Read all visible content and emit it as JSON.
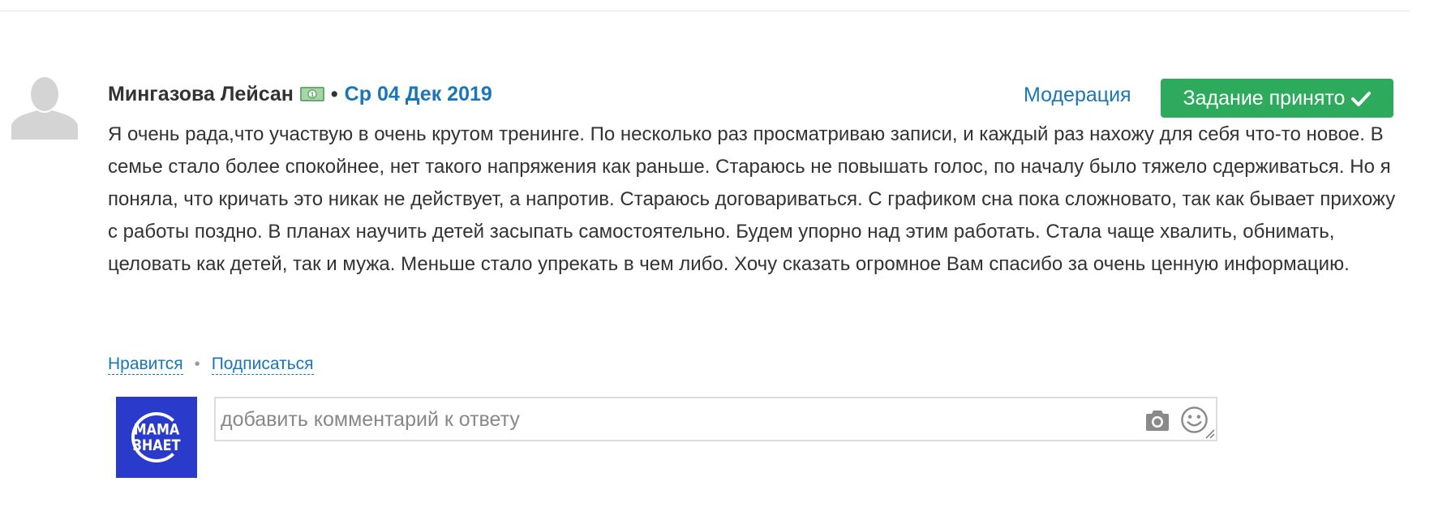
{
  "comment": {
    "author": "Мингазова Лейсан",
    "separator": "•",
    "date": "Ср 04 Дек 2019",
    "moderation_label": "Модерация",
    "status_button_label": "Задание принято",
    "text": "Я очень рада,что участвую в очень крутом тренинге. По несколько раз просматриваю записи, и каждый раз нахожу для себя что-то новое. В семье стало более спокойнее, нет такого напряжения как раньше. Стараюсь не повышать голос, по началу было тяжело сдерживаться. Но я поняла, что кричать это никак не действует, а напротив. Стараюсь договариваться. С графиком сна пока сложновато, так как бывает прихожу с работы поздно. В планах научить детей засыпать самостоятельно. Будем упорно над этим работать. Стала чаще хвалить, обнимать, целовать как детей, так и мужа. Меньше стало упрекать в чем либо. Хочу сказать огромное Вам спасибо за очень ценную информацию."
  },
  "actions": {
    "like_label": "Нравится",
    "separator": "•",
    "subscribe_label": "Подписаться"
  },
  "reply": {
    "placeholder": "добавить комментарий к ответу",
    "value": ""
  },
  "brand": {
    "line1": "МАМА",
    "line2": "ЗНАЕТ"
  },
  "icons": {
    "avatar": "user-silhouette-icon",
    "badge": "money-banknote-icon",
    "button": "checkmark-icon",
    "camera": "camera-icon",
    "emoji": "smiley-icon"
  },
  "colors": {
    "link": "#1976b8",
    "accepted_button": "#2eaa5c",
    "brand_background": "#2a3bcc",
    "text": "#333333",
    "placeholder": "#888888"
  }
}
